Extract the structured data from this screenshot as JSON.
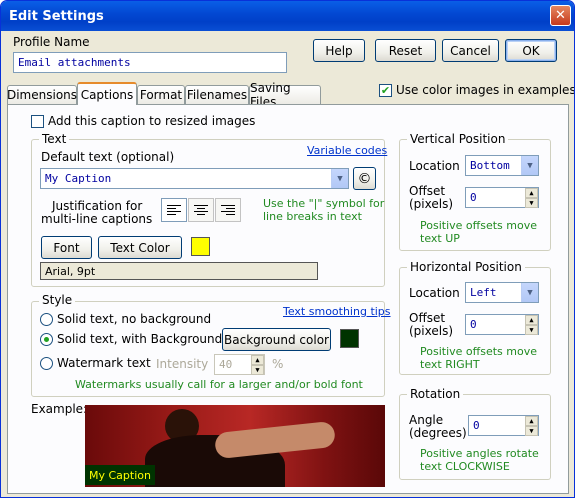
{
  "window": {
    "title": "Edit Settings",
    "close_glyph": "✕"
  },
  "profile": {
    "label": "Profile Name",
    "value": "Email attachments"
  },
  "buttons": {
    "help": "Help",
    "reset": "Reset",
    "cancel": "Cancel",
    "ok": "OK"
  },
  "use_color": {
    "label": "Use color images in examples",
    "checked": true
  },
  "tabs": [
    {
      "label": "Dimensions"
    },
    {
      "label": "Captions",
      "active": true
    },
    {
      "label": "Format"
    },
    {
      "label": "Filenames"
    },
    {
      "label": "Saving Files"
    }
  ],
  "captions": {
    "add_caption_label": "Add this caption to resized images",
    "add_caption_checked": false,
    "text": {
      "group_label": "Text",
      "default_text_label": "Default text (optional)",
      "variable_codes": "Variable codes",
      "value": "My Caption",
      "copyright_glyph": "©",
      "justification_label_1": "Justification for",
      "justification_label_2": "multi-line captions",
      "justification_selected": "left",
      "hint_1": "Use the \"|\" symbol for",
      "hint_2": "line breaks in text",
      "font_button": "Font",
      "text_color_button": "Text Color",
      "text_color": "#ffff00",
      "font_desc": "Arial, 9pt"
    },
    "style": {
      "group_label": "Style",
      "smoothing_link": "Text smoothing tips",
      "option_1": "Solid text, no background",
      "option_2": "Solid text, with Background",
      "option_3": "Watermark text",
      "selected": 2,
      "background_button": "Background color",
      "background_color": "#003300",
      "intensity_label": "Intensity",
      "intensity_value": "40",
      "percent": "%",
      "watermark_hint": "Watermarks usually call for a larger and/or bold font"
    },
    "example": {
      "label": "Example:",
      "caption": "My Caption"
    },
    "vertical": {
      "group_label": "Vertical Position",
      "location_label": "Location",
      "location_value": "Bottom",
      "offset_label_1": "Offset",
      "offset_label_2": "(pixels)",
      "offset_value": "0",
      "hint_1": "Positive offsets move",
      "hint_2": "text UP"
    },
    "horizontal": {
      "group_label": "Horizontal Position",
      "location_label": "Location",
      "location_value": "Left",
      "offset_label_1": "Offset",
      "offset_label_2": "(pixels)",
      "offset_value": "0",
      "hint_1": "Positive offsets move",
      "hint_2": "text RIGHT"
    },
    "rotation": {
      "group_label": "Rotation",
      "angle_label_1": "Angle",
      "angle_label_2": "(degrees)",
      "angle_value": "0",
      "hint_1": "Positive angles rotate",
      "hint_2": "text CLOCKWISE"
    }
  }
}
